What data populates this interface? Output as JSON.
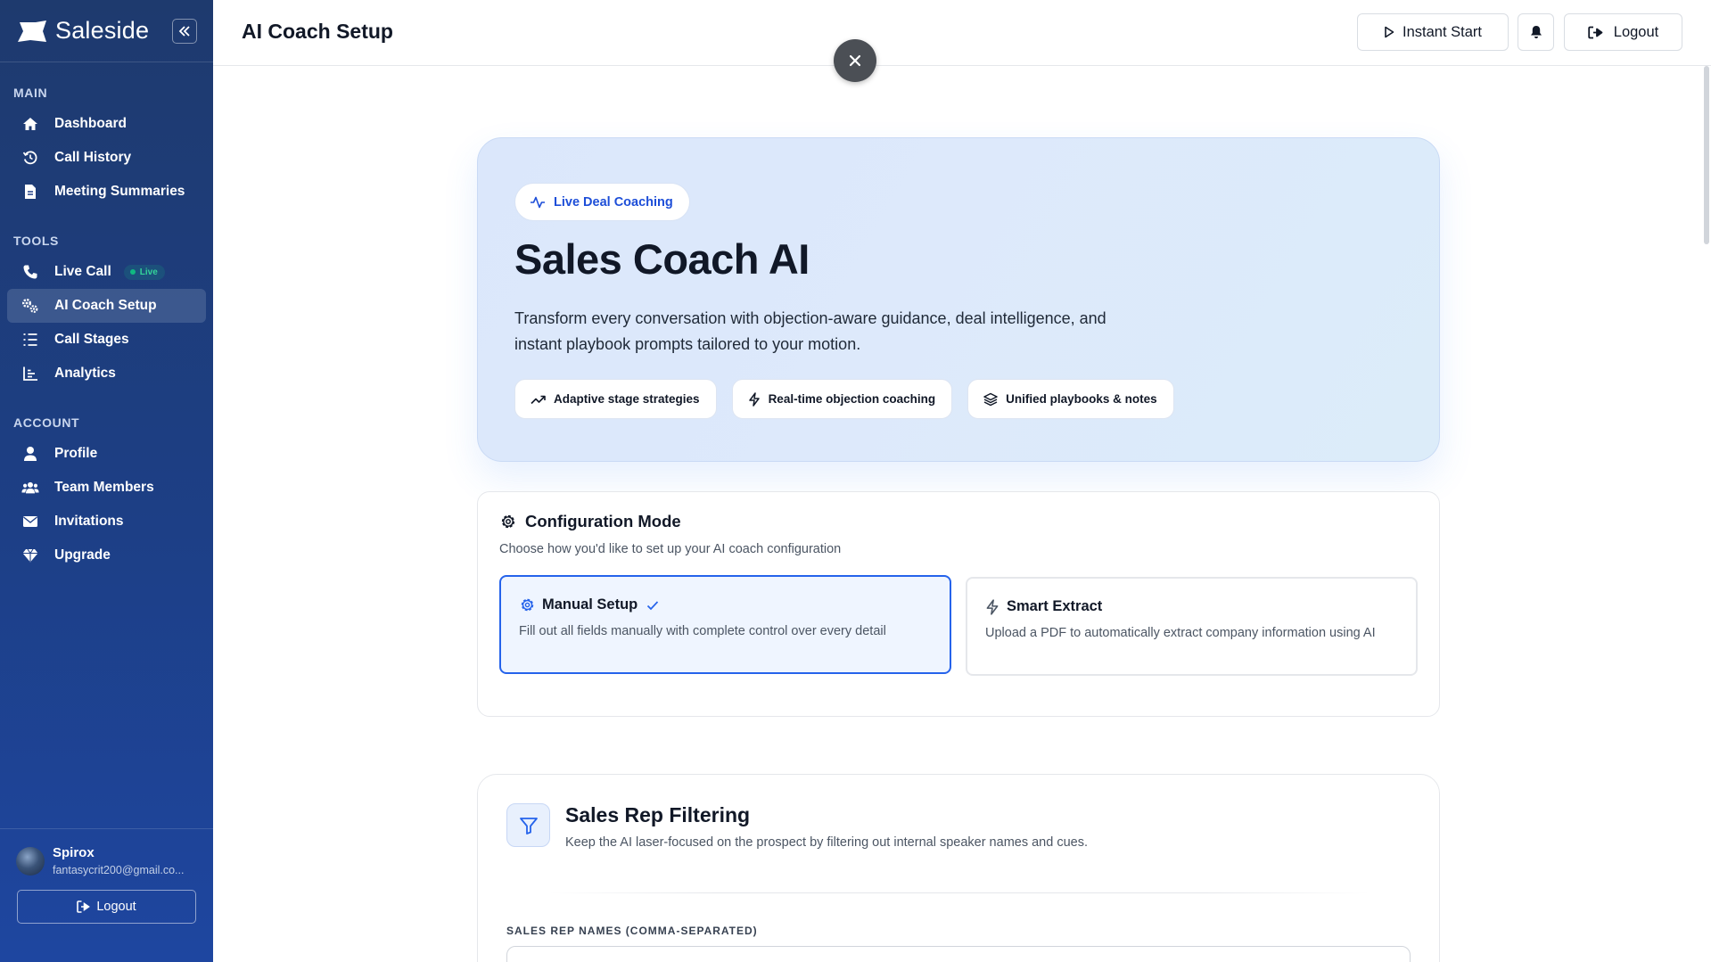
{
  "brand": {
    "name": "Saleside"
  },
  "sidebar": {
    "sections": [
      {
        "label": "MAIN"
      },
      {
        "label": "TOOLS"
      },
      {
        "label": "ACCOUNT"
      }
    ],
    "items": [
      {
        "label": "Dashboard",
        "icon": "home-icon"
      },
      {
        "label": "Call History",
        "icon": "history-icon"
      },
      {
        "label": "Meeting Summaries",
        "icon": "document-icon"
      },
      {
        "label": "Live Call",
        "icon": "phone-icon",
        "badge": "Live"
      },
      {
        "label": "AI Coach Setup",
        "icon": "gears-icon",
        "active": true
      },
      {
        "label": "Call Stages",
        "icon": "list-icon"
      },
      {
        "label": "Analytics",
        "icon": "chart-icon"
      },
      {
        "label": "Profile",
        "icon": "user-icon"
      },
      {
        "label": "Team Members",
        "icon": "users-icon"
      },
      {
        "label": "Invitations",
        "icon": "envelope-icon"
      },
      {
        "label": "Upgrade",
        "icon": "gem-icon"
      }
    ],
    "user": {
      "name": "Spirox",
      "email": "fantasycrit200@gmail.co..."
    },
    "logout_label": "Logout"
  },
  "topbar": {
    "title": "AI Coach Setup",
    "instant_start_label": "Instant Start",
    "logout_label": "Logout"
  },
  "hero": {
    "chip": "Live Deal Coaching",
    "title": "Sales Coach AI",
    "description": "Transform every conversation with objection-aware guidance, deal intelligence, and instant playbook prompts tailored to your motion.",
    "features": [
      {
        "label": "Adaptive stage strategies",
        "icon": "trend-icon"
      },
      {
        "label": "Real-time objection coaching",
        "icon": "bolt-icon"
      },
      {
        "label": "Unified playbooks & notes",
        "icon": "layers-icon"
      }
    ]
  },
  "config": {
    "title": "Configuration Mode",
    "subtitle": "Choose how you'd like to set up your AI coach configuration",
    "options": [
      {
        "title": "Manual Setup",
        "description": "Fill out all fields manually with complete control over every detail",
        "selected": true
      },
      {
        "title": "Smart Extract",
        "description": "Upload a PDF to automatically extract company information using AI",
        "selected": false
      }
    ]
  },
  "filter": {
    "title": "Sales Rep Filtering",
    "subtitle": "Keep the AI laser-focused on the prospect by filtering out internal speaker names and cues.",
    "field_label": "SALES REP NAMES (COMMA-SEPARATED)",
    "field_value": "",
    "field_placeholder": ""
  },
  "colors": {
    "sidebar_bg": "#1e3a6e",
    "accent": "#2563eb",
    "live_green": "#10b981"
  }
}
